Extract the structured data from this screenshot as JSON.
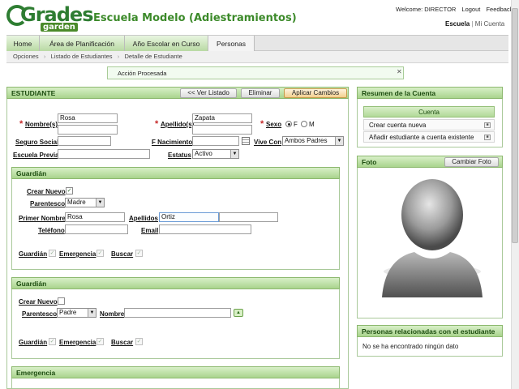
{
  "logo": {
    "word1": "Grades",
    "word2": "garden"
  },
  "school_title": "Escuela Modelo (Adiestramientos)",
  "toplinks": {
    "welcome": "Welcome: DIRECTOR",
    "logout": "Logout",
    "feedback": "Feedback"
  },
  "subnav": {
    "escuela": "Escuela",
    "sep": "|",
    "mi_cuenta": "Mi Cuenta"
  },
  "tabs": [
    "Home",
    "Área de Planificación",
    "Año Escolar en Curso",
    "Personas"
  ],
  "active_tab": "Personas",
  "breadcrumbs": [
    "Opciones",
    "Listado de Estudiantes",
    "Detalle de Estudiante"
  ],
  "breadcrumb_sep": "›",
  "alert": {
    "message": "Acción Procesada",
    "close": "✕"
  },
  "student": {
    "title": "ESTUDIANTE",
    "buttons": {
      "back": "<< Ver Listado",
      "delete": "Eliminar",
      "apply": "Aplicar Cambios"
    },
    "required_mark": "*",
    "nombre_label": "Nombre(s)",
    "nombre_value": "Rosa",
    "apellidos_label": "Apellido(s)",
    "apellidos_value": "Zapata",
    "sexo_label": "Sexo",
    "sexo_f": "F",
    "sexo_m": "M",
    "ss_label": "Seguro Social",
    "nacimiento_label": "F Nacimiento",
    "vive_label": "Vive Con",
    "vive_value": "Ambos Padres",
    "escuela_previa_label": "Escuela Previa",
    "estatus_label": "Estatus",
    "estatus_value": "Activo"
  },
  "guardian1": {
    "title": "Guardián",
    "crear_nuevo": "Crear Nuevo",
    "crear_checked": "✓",
    "parentesco_label": "Parentesco",
    "parentesco_value": "Madre",
    "primer_nombre_label": "Primer Nombre",
    "primer_nombre_value": "Rosa",
    "apellidos_label": "Apellidos",
    "apellidos_value": "Ortiz",
    "telefono_label": "Teléfono",
    "email_label": "Email",
    "flags": {
      "guardian": "Guardián",
      "emergencia": "Emergencia",
      "buscar": "Buscar"
    }
  },
  "guardian2": {
    "title": "Guardián",
    "crear_nuevo": "Crear Nuevo",
    "parentesco_label": "Parentesco",
    "parentesco_value": "Padre",
    "nombre_label": "Nombre",
    "flags": {
      "guardian": "Guardián",
      "emergencia": "Emergencia",
      "buscar": "Buscar"
    }
  },
  "emergency": {
    "title": "Emergencia"
  },
  "account_summary": {
    "title": "Resumen de la Cuenta",
    "header": "Cuenta",
    "items": [
      "Crear cuenta nueva",
      "Añadir estudiante a cuenta existente"
    ]
  },
  "photo": {
    "title": "Foto",
    "change_button": "Cambiar Foto"
  },
  "related": {
    "title": "Personas relacionadas con el estudiante",
    "empty": "No se ha encontrado ningún dato"
  },
  "icons": {
    "calendar": "calendar-icon",
    "add": "add-icon",
    "close": "close-icon",
    "avatar": "avatar-silhouette"
  },
  "colors": {
    "brand_green": "#3c8a2a",
    "panel_green": "#a9d48d",
    "required_red": "#c62828",
    "apply_orange": "#f2cf8e"
  }
}
